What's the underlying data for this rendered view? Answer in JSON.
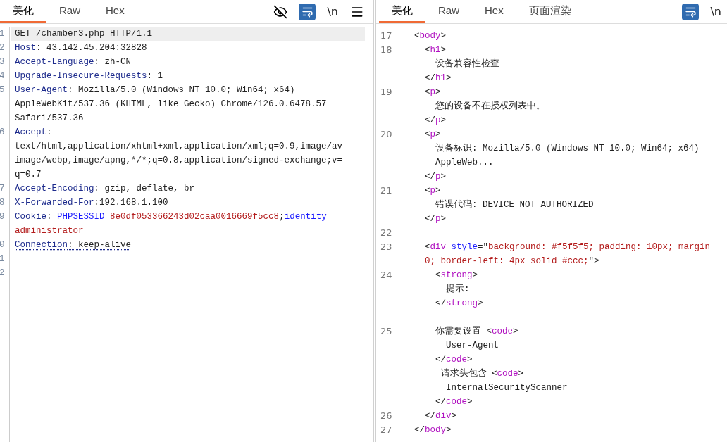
{
  "request_pane": {
    "tabs": [
      {
        "label": "美化",
        "selected": true
      },
      {
        "label": "Raw",
        "selected": false
      },
      {
        "label": "Hex",
        "selected": false
      }
    ],
    "toolbar": [
      {
        "kind": "eye_off"
      },
      {
        "kind": "wrap",
        "active": true
      },
      {
        "kind": "text",
        "label": "\\n"
      },
      {
        "kind": "menu"
      }
    ],
    "lines": [
      {
        "number": "1",
        "highlighted": true,
        "flagged": false,
        "rows": [
          {
            "kind": "code",
            "segments": [
              {
                "kind": "plain",
                "text": "GET /chamber3.php HTTP/1.1"
              }
            ]
          }
        ]
      },
      {
        "number": "2",
        "highlighted": false,
        "flagged": false,
        "rows": [
          {
            "kind": "code",
            "segments": [
              {
                "kind": "key",
                "text": "Host"
              },
              {
                "kind": "plain",
                "text": ": 43.142.45.204:32828"
              }
            ]
          }
        ]
      },
      {
        "number": "3",
        "highlighted": false,
        "flagged": false,
        "rows": [
          {
            "kind": "code",
            "segments": [
              {
                "kind": "key",
                "text": "Accept-Language"
              },
              {
                "kind": "plain",
                "text": ": zh-CN"
              }
            ]
          }
        ]
      },
      {
        "number": "4",
        "highlighted": false,
        "flagged": false,
        "rows": [
          {
            "kind": "code",
            "segments": [
              {
                "kind": "key",
                "text": "Upgrade-Insecure-Requests"
              },
              {
                "kind": "plain",
                "text": ": 1"
              }
            ]
          }
        ]
      },
      {
        "number": "5",
        "highlighted": false,
        "flagged": false,
        "rows": [
          {
            "kind": "code",
            "segments": [
              {
                "kind": "key",
                "text": "User-Agent"
              },
              {
                "kind": "plain",
                "text": ": Mozilla/5.0 (Windows NT 10.0; Win64; x64)"
              }
            ]
          },
          {
            "kind": "code",
            "segments": [
              {
                "kind": "plain",
                "text": "AppleWebKit/537.36 (KHTML, like Gecko) Chrome/126.0.6478.57"
              }
            ]
          },
          {
            "kind": "code",
            "segments": [
              {
                "kind": "plain",
                "text": "Safari/537.36"
              }
            ]
          }
        ]
      },
      {
        "number": "6",
        "highlighted": false,
        "flagged": false,
        "rows": [
          {
            "kind": "code",
            "segments": [
              {
                "kind": "key",
                "text": "Accept"
              },
              {
                "kind": "plain",
                "text": ":"
              }
            ]
          },
          {
            "kind": "code",
            "segments": [
              {
                "kind": "plain",
                "text": "text/html,application/xhtml+xml,application/xml;q=0.9,image/av"
              }
            ]
          },
          {
            "kind": "code",
            "segments": [
              {
                "kind": "plain",
                "text": "image/webp,image/apng,*/*;q=0.8,application/signed-exchange;v="
              }
            ]
          },
          {
            "kind": "code",
            "segments": [
              {
                "kind": "plain",
                "text": "q=0.7"
              }
            ]
          }
        ]
      },
      {
        "number": "7",
        "highlighted": false,
        "flagged": false,
        "rows": [
          {
            "kind": "code",
            "segments": [
              {
                "kind": "key",
                "text": "Accept-Encoding"
              },
              {
                "kind": "plain",
                "text": ": gzip, deflate, br"
              }
            ]
          }
        ]
      },
      {
        "number": "8",
        "highlighted": false,
        "flagged": false,
        "rows": [
          {
            "kind": "code",
            "segments": [
              {
                "kind": "key",
                "text": "X-Forwarded-For"
              },
              {
                "kind": "plain",
                "text": ":192.168.1.100"
              }
            ]
          }
        ]
      },
      {
        "number": "9",
        "highlighted": false,
        "flagged": false,
        "rows": [
          {
            "kind": "code",
            "segments": [
              {
                "kind": "key",
                "text": "Cookie"
              },
              {
                "kind": "plain",
                "text": ": "
              },
              {
                "kind": "cookie_name",
                "text": "PHPSESSID"
              },
              {
                "kind": "plain",
                "text": "="
              },
              {
                "kind": "cookie_value",
                "text": "8e0df053366243d02caa0016669f5cc8"
              },
              {
                "kind": "plain",
                "text": ";"
              },
              {
                "kind": "cookie_name",
                "text": "identity"
              },
              {
                "kind": "plain",
                "text": "="
              }
            ]
          },
          {
            "kind": "code",
            "segments": [
              {
                "kind": "cookie_value",
                "text": "administrator"
              }
            ]
          }
        ]
      },
      {
        "number": "0",
        "highlighted": false,
        "flagged": true,
        "rows": [
          {
            "kind": "code",
            "segments": [
              {
                "kind": "key",
                "text": "Connection"
              },
              {
                "kind": "plain",
                "text": ": keep-alive"
              }
            ]
          }
        ]
      },
      {
        "number": "1",
        "highlighted": false,
        "rows": [
          {
            "kind": "blank"
          }
        ]
      },
      {
        "number": "2",
        "highlighted": false,
        "rows": [
          {
            "kind": "blank"
          }
        ]
      }
    ]
  },
  "response_pane": {
    "tabs": [
      {
        "label": "美化",
        "selected": true
      },
      {
        "label": "Raw",
        "selected": false
      },
      {
        "label": "Hex",
        "selected": false
      },
      {
        "label": "页面渲染",
        "selected": false
      }
    ],
    "toolbar": [
      {
        "kind": "wrap",
        "active": true
      },
      {
        "kind": "text",
        "label": "\\n"
      }
    ],
    "lines": [
      {
        "number": "17",
        "rows": [
          {
            "kind": "code",
            "segments": [
              {
                "kind": "plain",
                "text": "  <"
              },
              {
                "kind": "tag",
                "text": "body"
              },
              {
                "kind": "plain",
                "text": ">"
              }
            ]
          }
        ]
      },
      {
        "number": "18",
        "rows": [
          {
            "kind": "code",
            "segments": [
              {
                "kind": "plain",
                "text": "    <"
              },
              {
                "kind": "tag",
                "text": "h1"
              },
              {
                "kind": "plain",
                "text": ">"
              }
            ]
          },
          {
            "kind": "code",
            "segments": [
              {
                "kind": "plain",
                "text": "      设备兼容性检查"
              }
            ]
          },
          {
            "kind": "code",
            "segments": [
              {
                "kind": "plain",
                "text": "    </"
              },
              {
                "kind": "tag",
                "text": "h1"
              },
              {
                "kind": "plain",
                "text": ">"
              }
            ]
          }
        ]
      },
      {
        "number": "19",
        "rows": [
          {
            "kind": "code",
            "segments": [
              {
                "kind": "plain",
                "text": "    <"
              },
              {
                "kind": "tag",
                "text": "p"
              },
              {
                "kind": "plain",
                "text": ">"
              }
            ]
          },
          {
            "kind": "code",
            "segments": [
              {
                "kind": "plain",
                "text": "      您的设备不在授权列表中。"
              }
            ]
          },
          {
            "kind": "code",
            "segments": [
              {
                "kind": "plain",
                "text": "    </"
              },
              {
                "kind": "tag",
                "text": "p"
              },
              {
                "kind": "plain",
                "text": ">"
              }
            ]
          }
        ]
      },
      {
        "number": "20",
        "rows": [
          {
            "kind": "code",
            "segments": [
              {
                "kind": "plain",
                "text": "    <"
              },
              {
                "kind": "tag",
                "text": "p"
              },
              {
                "kind": "plain",
                "text": ">"
              }
            ]
          },
          {
            "kind": "code",
            "segments": [
              {
                "kind": "plain",
                "text": "      设备标识: Mozilla/5.0 (Windows NT 10.0; Win64; x64)"
              }
            ]
          },
          {
            "kind": "code",
            "segments": [
              {
                "kind": "plain",
                "text": "      AppleWeb..."
              }
            ]
          },
          {
            "kind": "code",
            "segments": [
              {
                "kind": "plain",
                "text": "    </"
              },
              {
                "kind": "tag",
                "text": "p"
              },
              {
                "kind": "plain",
                "text": ">"
              }
            ]
          }
        ]
      },
      {
        "number": "21",
        "rows": [
          {
            "kind": "code",
            "segments": [
              {
                "kind": "plain",
                "text": "    <"
              },
              {
                "kind": "tag",
                "text": "p"
              },
              {
                "kind": "plain",
                "text": ">"
              }
            ]
          },
          {
            "kind": "code",
            "segments": [
              {
                "kind": "plain",
                "text": "      错误代码: DEVICE_NOT_AUTHORIZED"
              }
            ]
          },
          {
            "kind": "code",
            "segments": [
              {
                "kind": "plain",
                "text": "    </"
              },
              {
                "kind": "tag",
                "text": "p"
              },
              {
                "kind": "plain",
                "text": ">"
              }
            ]
          }
        ]
      },
      {
        "number": "22",
        "rows": [
          {
            "kind": "blank"
          }
        ]
      },
      {
        "number": "23",
        "rows": [
          {
            "kind": "code",
            "segments": [
              {
                "kind": "plain",
                "text": "    <"
              },
              {
                "kind": "tag",
                "text": "div"
              },
              {
                "kind": "attr",
                "text": " style"
              },
              {
                "kind": "plain",
                "text": "=\""
              },
              {
                "kind": "string",
                "text": "background: #f5f5f5; padding: 10px; margin"
              }
            ]
          },
          {
            "kind": "code",
            "segments": [
              {
                "kind": "string",
                "text": "    0; border-left: 4px solid #ccc;"
              },
              {
                "kind": "plain",
                "text": "\">"
              }
            ]
          }
        ]
      },
      {
        "number": "24",
        "rows": [
          {
            "kind": "code",
            "segments": [
              {
                "kind": "plain",
                "text": "      <"
              },
              {
                "kind": "tag",
                "text": "strong"
              },
              {
                "kind": "plain",
                "text": ">"
              }
            ]
          },
          {
            "kind": "code",
            "segments": [
              {
                "kind": "plain",
                "text": "        提示:"
              }
            ]
          },
          {
            "kind": "code",
            "segments": [
              {
                "kind": "plain",
                "text": "      </"
              },
              {
                "kind": "tag",
                "text": "strong"
              },
              {
                "kind": "plain",
                "text": ">"
              }
            ]
          },
          {
            "kind": "blank"
          }
        ]
      },
      {
        "number": "25",
        "rows": [
          {
            "kind": "code",
            "segments": [
              {
                "kind": "plain",
                "text": "      你需要设置 <"
              },
              {
                "kind": "tag",
                "text": "code"
              },
              {
                "kind": "plain",
                "text": ">"
              }
            ]
          },
          {
            "kind": "code",
            "segments": [
              {
                "kind": "plain",
                "text": "        User-Agent"
              }
            ]
          },
          {
            "kind": "code",
            "segments": [
              {
                "kind": "plain",
                "text": "      </"
              },
              {
                "kind": "tag",
                "text": "code"
              },
              {
                "kind": "plain",
                "text": ">"
              }
            ]
          },
          {
            "kind": "code",
            "segments": [
              {
                "kind": "plain",
                "text": "       请求头包含 <"
              },
              {
                "kind": "tag",
                "text": "code"
              },
              {
                "kind": "plain",
                "text": ">"
              }
            ]
          },
          {
            "kind": "code",
            "segments": [
              {
                "kind": "plain",
                "text": "        InternalSecurityScanner"
              }
            ]
          },
          {
            "kind": "code",
            "segments": [
              {
                "kind": "plain",
                "text": "      </"
              },
              {
                "kind": "tag",
                "text": "code"
              },
              {
                "kind": "plain",
                "text": ">"
              }
            ]
          }
        ]
      },
      {
        "number": "26",
        "rows": [
          {
            "kind": "code",
            "segments": [
              {
                "kind": "plain",
                "text": "    </"
              },
              {
                "kind": "tag",
                "text": "div"
              },
              {
                "kind": "plain",
                "text": ">"
              }
            ]
          }
        ]
      },
      {
        "number": "27",
        "rows": [
          {
            "kind": "code",
            "segments": [
              {
                "kind": "plain",
                "text": "  </"
              },
              {
                "kind": "tag",
                "text": "body"
              },
              {
                "kind": "plain",
                "text": ">"
              }
            ]
          }
        ]
      }
    ]
  }
}
